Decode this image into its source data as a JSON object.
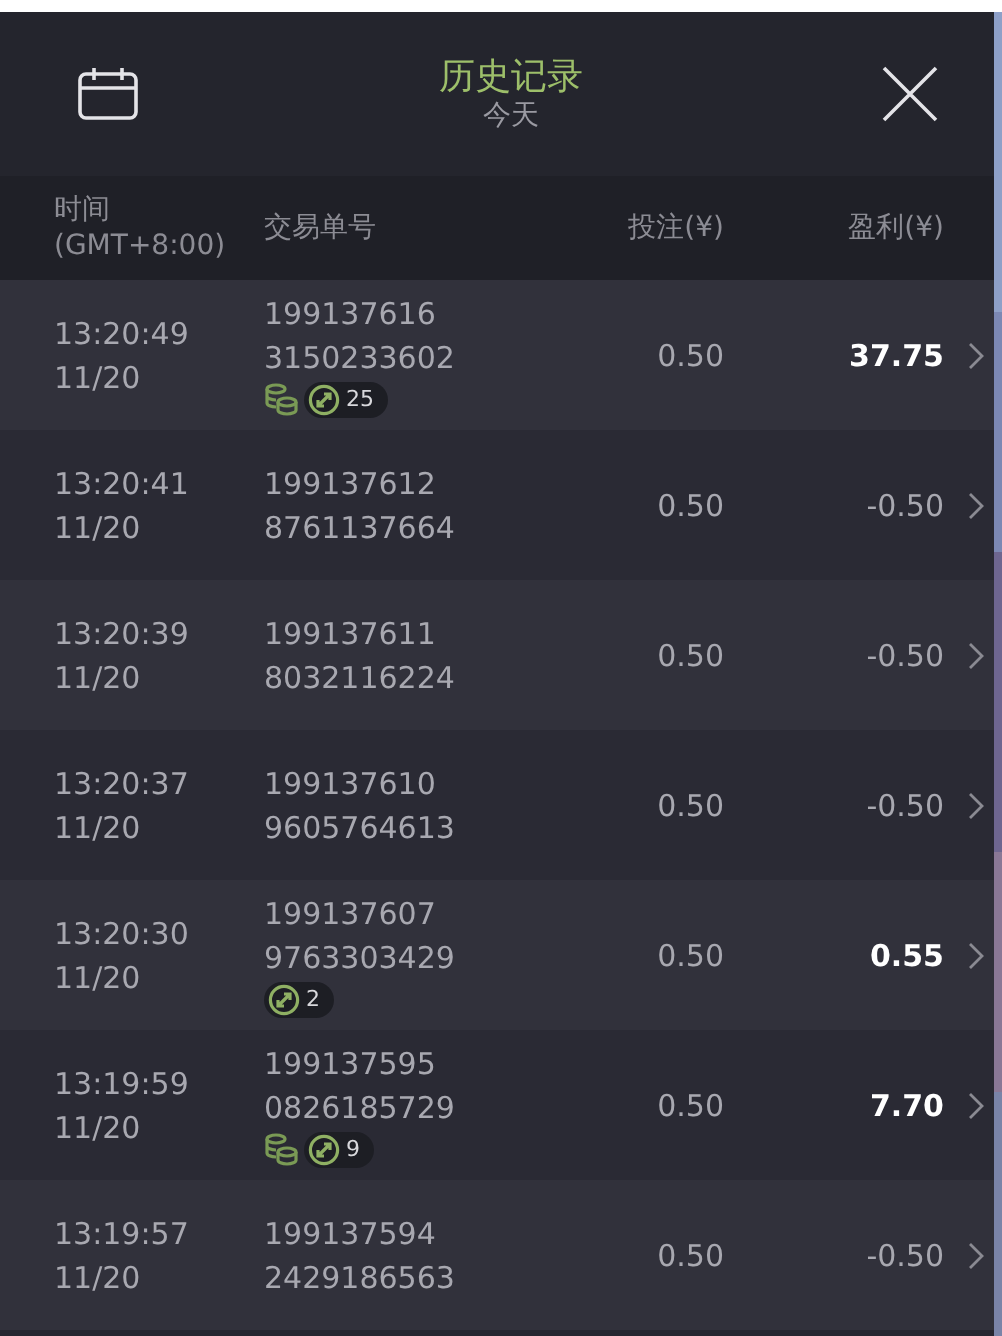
{
  "header": {
    "title": "历史记录",
    "subtitle": "今天"
  },
  "columns": {
    "time": [
      "时间",
      "(GMT+8:00)"
    ],
    "order": "交易单号",
    "bet": "投注(¥)",
    "profit": "盈利(¥)"
  },
  "rows": [
    {
      "time": "13:20:49",
      "date": "11/20",
      "order": [
        "199137616",
        "3150233602"
      ],
      "bet": "0.50",
      "profit": "37.75",
      "win": true,
      "coins": true,
      "count": "25"
    },
    {
      "time": "13:20:41",
      "date": "11/20",
      "order": [
        "199137612",
        "8761137664"
      ],
      "bet": "0.50",
      "profit": "-0.50",
      "win": false,
      "coins": false
    },
    {
      "time": "13:20:39",
      "date": "11/20",
      "order": [
        "199137611",
        "8032116224"
      ],
      "bet": "0.50",
      "profit": "-0.50",
      "win": false,
      "coins": false
    },
    {
      "time": "13:20:37",
      "date": "11/20",
      "order": [
        "199137610",
        "9605764613"
      ],
      "bet": "0.50",
      "profit": "-0.50",
      "win": false,
      "coins": false
    },
    {
      "time": "13:20:30",
      "date": "11/20",
      "order": [
        "199137607",
        "9763303429"
      ],
      "bet": "0.50",
      "profit": "0.55",
      "win": true,
      "coins": false,
      "count": "2"
    },
    {
      "time": "13:19:59",
      "date": "11/20",
      "order": [
        "199137595",
        "0826185729"
      ],
      "bet": "0.50",
      "profit": "7.70",
      "win": true,
      "coins": true,
      "count": "9"
    },
    {
      "time": "13:19:57",
      "date": "11/20",
      "order": [
        "199137594",
        "2429186563"
      ],
      "bet": "0.50",
      "profit": "-0.50",
      "win": false,
      "coins": false
    }
  ]
}
